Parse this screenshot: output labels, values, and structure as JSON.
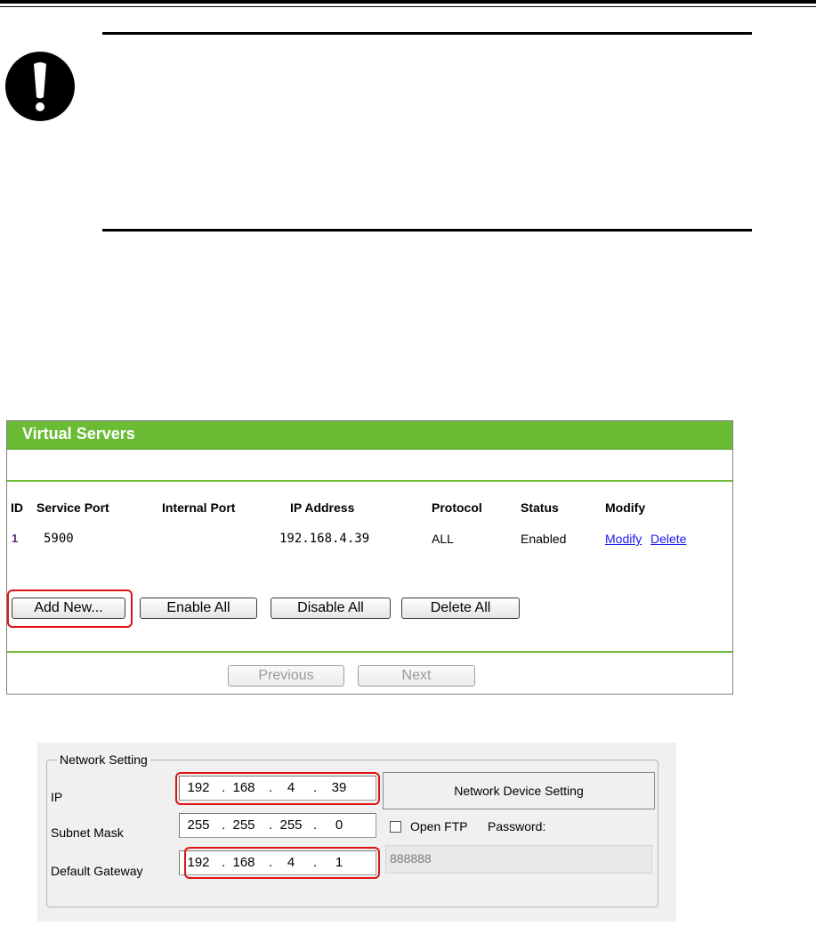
{
  "virtual_servers": {
    "title": "Virtual Servers",
    "columns": [
      "ID",
      "Service Port",
      "Internal Port",
      "IP Address",
      "Protocol",
      "Status",
      "Modify"
    ],
    "rows": [
      {
        "id": "1",
        "service_port": "5900",
        "internal_port": "",
        "ip_address": "192.168.4.39",
        "protocol": "ALL",
        "status": "Enabled",
        "modify_link": "Modify",
        "delete_link": "Delete"
      }
    ],
    "buttons": {
      "add_new": "Add New...",
      "enable_all": "Enable All",
      "disable_all": "Disable All",
      "delete_all": "Delete All",
      "previous": "Previous",
      "next": "Next"
    },
    "accent_color": "#6bbb35"
  },
  "network_setting": {
    "legend": "Network Setting",
    "labels": {
      "ip": "IP",
      "subnet_mask": "Subnet Mask",
      "default_gateway": "Default Gateway"
    },
    "ip": [
      "192",
      "168",
      "4",
      "39"
    ],
    "subnet_mask": [
      "255",
      "255",
      "255",
      "0"
    ],
    "default_gateway": [
      "192",
      "168",
      "4",
      "1"
    ],
    "network_device_setting_button": "Network Device Setting",
    "open_ftp_label": "Open FTP",
    "open_ftp_checked": false,
    "password_label": "Password:",
    "password_value": "888888"
  },
  "highlight_color": "#e01414",
  "icons": {
    "warning": "exclamation-icon"
  }
}
